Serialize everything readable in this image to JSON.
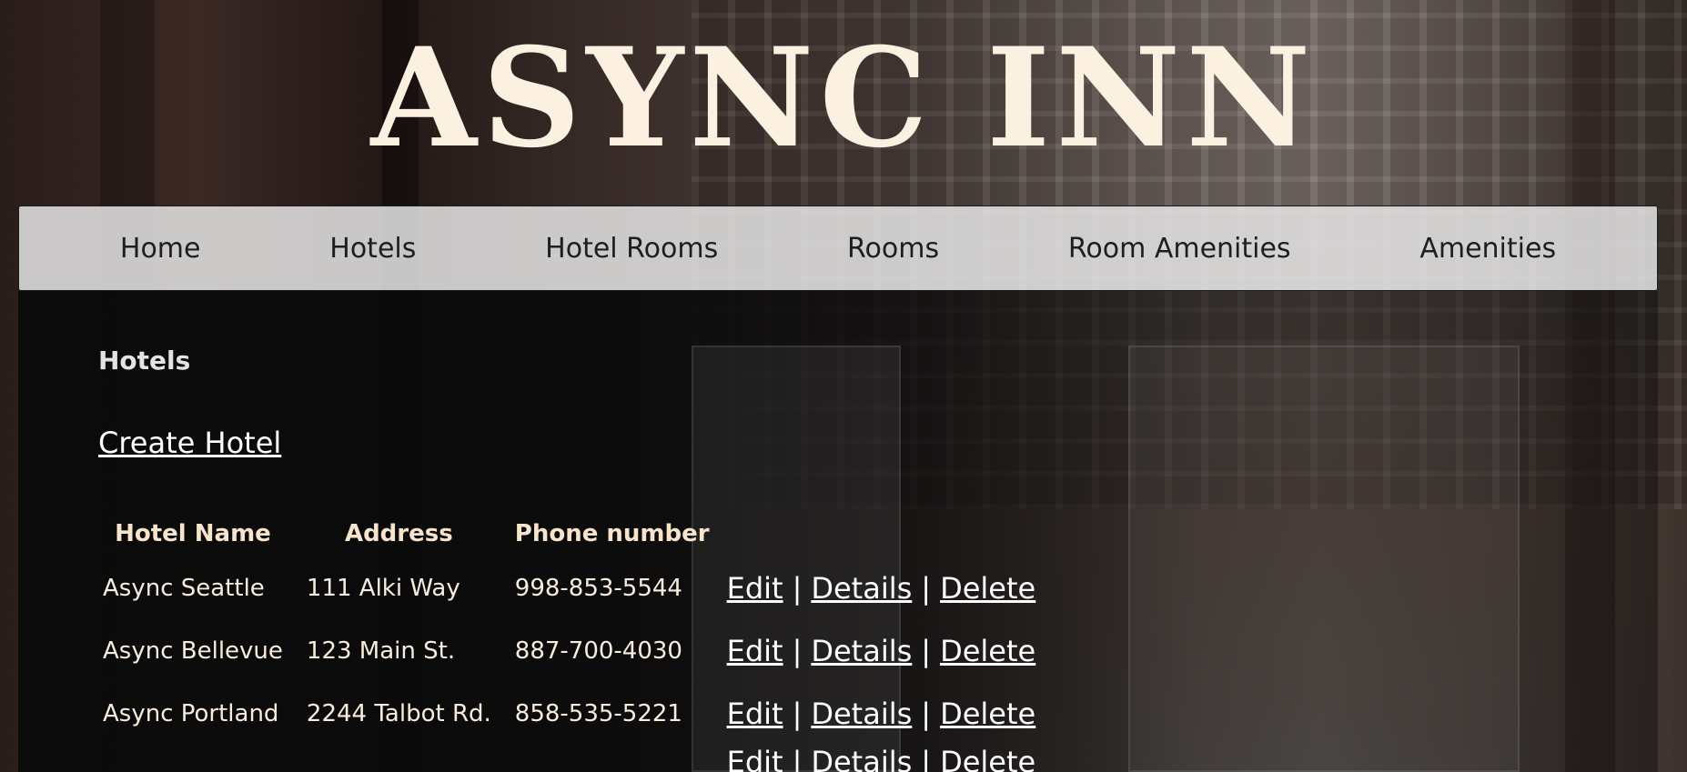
{
  "site_title": "ASYNC INN",
  "nav": {
    "items": [
      "Home",
      "Hotels",
      "Hotel Rooms",
      "Rooms",
      "Room Amenities",
      "Amenities"
    ]
  },
  "page": {
    "heading": "Hotels",
    "create_link": "Create Hotel"
  },
  "table": {
    "columns": [
      "Hotel Name",
      "Address",
      "Phone number"
    ],
    "rows": [
      {
        "name": "Async Seattle",
        "address": "111 Alki Way",
        "phone": "998-853-5544"
      },
      {
        "name": "Async Bellevue",
        "address": "123 Main St.",
        "phone": "887-700-4030"
      },
      {
        "name": "Async Portland",
        "address": "2244 Talbot Rd.",
        "phone": "858-535-5221"
      }
    ],
    "actions": {
      "edit": "Edit",
      "details": "Details",
      "delete": "Delete",
      "separator": "|"
    }
  }
}
